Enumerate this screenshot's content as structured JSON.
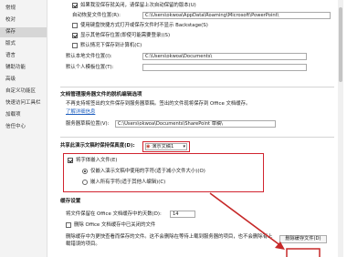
{
  "sidebar": {
    "items": [
      {
        "label": "常规"
      },
      {
        "label": "校对"
      },
      {
        "label": "保存"
      },
      {
        "label": "版式"
      },
      {
        "label": "语言"
      },
      {
        "label": "辅助功能"
      },
      {
        "label": "高级"
      },
      {
        "label": "自定义功能区"
      },
      {
        "label": "快速访问工具栏"
      },
      {
        "label": "加载项"
      },
      {
        "label": "信任中心"
      }
    ],
    "active_index": 2
  },
  "save": {
    "keep_last_autosaved": "如果我没保存就关闭，请保留上次自动保留的版本(U)",
    "autorecover_label": "自动恢复文件位置(R):",
    "autorecover_path": "C:\\Users\\okwoa\\AppData\\Roaming\\Microsoft\\PowerPoint\\",
    "keyboard_shortcuts": "使用键盘快捷方式打开或保存文件时不显示 Backstage(S)",
    "show_additional": "显示其他保存位置(即使可能需要登录)(S)",
    "default_computer": "默认情况下保存到计算机(C)",
    "local_location_label": "默认本地文件位置(I):",
    "local_location_path": "C:\\Users\\okwoa\\Documents\\",
    "personal_templates_label": "默认个人模板位置(T):",
    "personal_templates_path": ""
  },
  "offline": {
    "heading": "文档管理服务器文件的脱机编辑选项",
    "description": "不再支持将签出的文件保存到服务器草稿。签出的文件现将保存到 Office 文档缓存。",
    "learn_more": "了解详细信息",
    "drafts_label": "服务器草稿位置(V):",
    "drafts_path": "C:\\Users\\okwoa\\Documents\\SharePoint 草稿\\"
  },
  "fidelity": {
    "label": "共享此演示文稿时保持保真度(D):",
    "doc_name": "演示文稿1",
    "embed_fonts": "将字体嵌入文件(E)",
    "option_used_only": "仅嵌入演示文稿中使用的字符(适于减小文件大小)(O)",
    "option_all": "嵌入所有字符(适于其他人编辑)(C)"
  },
  "cache": {
    "heading": "缓存设置",
    "days_label": "将文件保留在 Office 文档缓存中的天数(D):",
    "days_value": "14",
    "delete_on_close": "删除 Office 文档缓存中已关闭的文件",
    "description": "删除缓存中为更快查看而保存的文件。这不会删除在等待上载到服务器的项目，也不会删除有上载错误的项目。",
    "delete_button": "删除缓存文件(D)"
  }
}
